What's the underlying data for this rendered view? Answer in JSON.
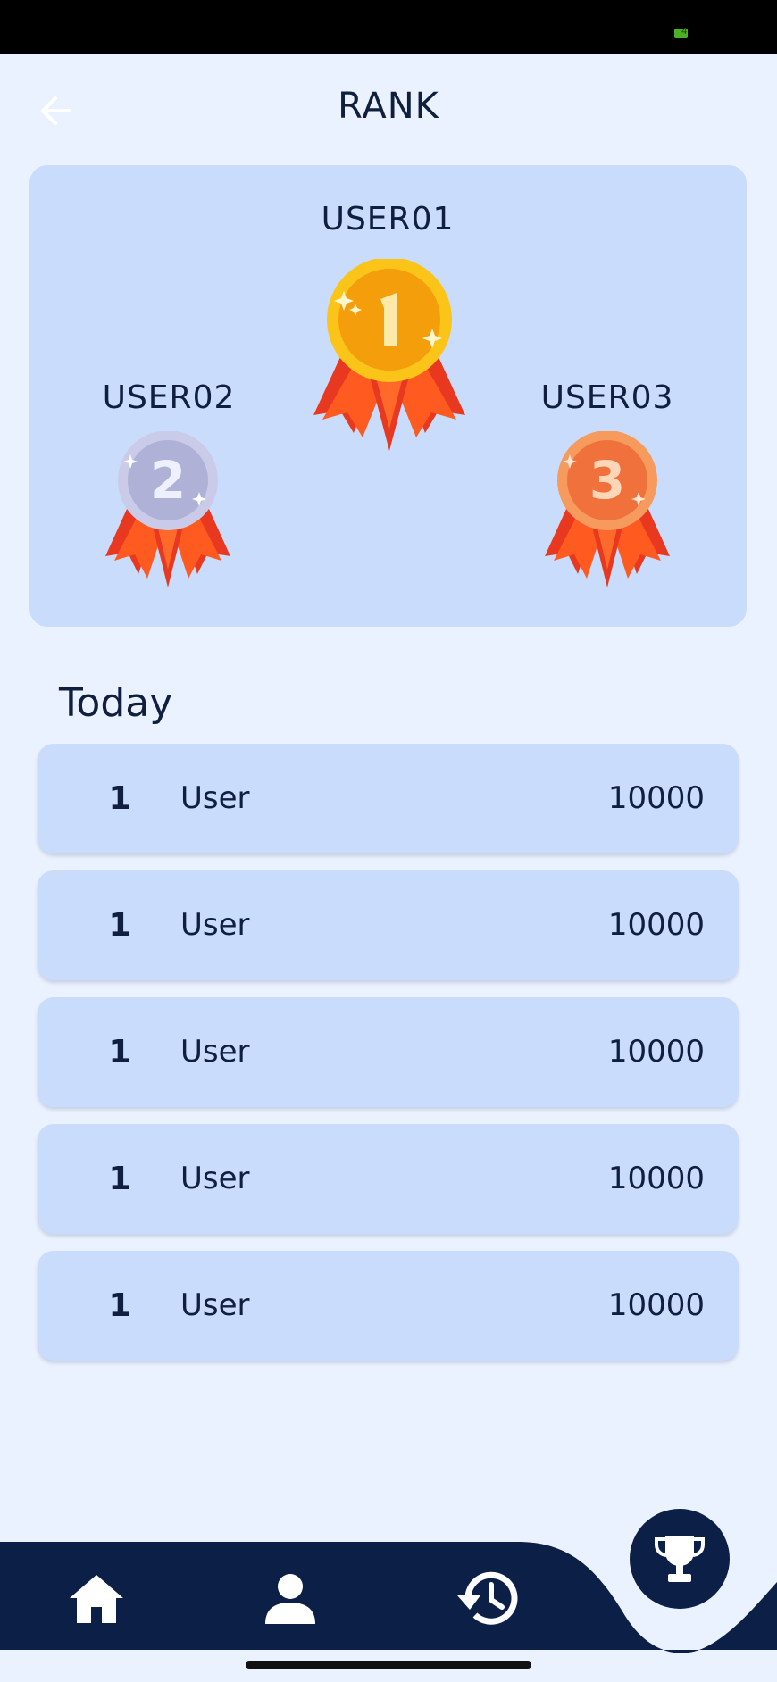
{
  "status_bar": {
    "battery_level": "4",
    "battery_color": "#4CAF27"
  },
  "header": {
    "title": "RANK",
    "back_icon": "arrow-left-icon"
  },
  "podium": {
    "first": {
      "name": "USER01",
      "place": "1",
      "medal_color": "#F5A511"
    },
    "second": {
      "name": "USER02",
      "place": "2",
      "medal_color": "#B3B7DA"
    },
    "third": {
      "name": "USER03",
      "place": "3",
      "medal_color": "#F0713B"
    }
  },
  "section": {
    "title": "Today"
  },
  "leaderboard": [
    {
      "rank": "1",
      "name": "User",
      "score": "10000"
    },
    {
      "rank": "1",
      "name": "User",
      "score": "10000"
    },
    {
      "rank": "1",
      "name": "User",
      "score": "10000"
    },
    {
      "rank": "1",
      "name": "User",
      "score": "10000"
    },
    {
      "rank": "1",
      "name": "User",
      "score": "10000"
    }
  ],
  "nav": {
    "items": [
      {
        "icon": "home-icon",
        "active": false
      },
      {
        "icon": "person-icon",
        "active": false
      },
      {
        "icon": "history-icon",
        "active": false
      },
      {
        "icon": "trophy-icon",
        "active": true
      }
    ],
    "background": "#0B1F47",
    "accent": "#FFFFFF"
  }
}
